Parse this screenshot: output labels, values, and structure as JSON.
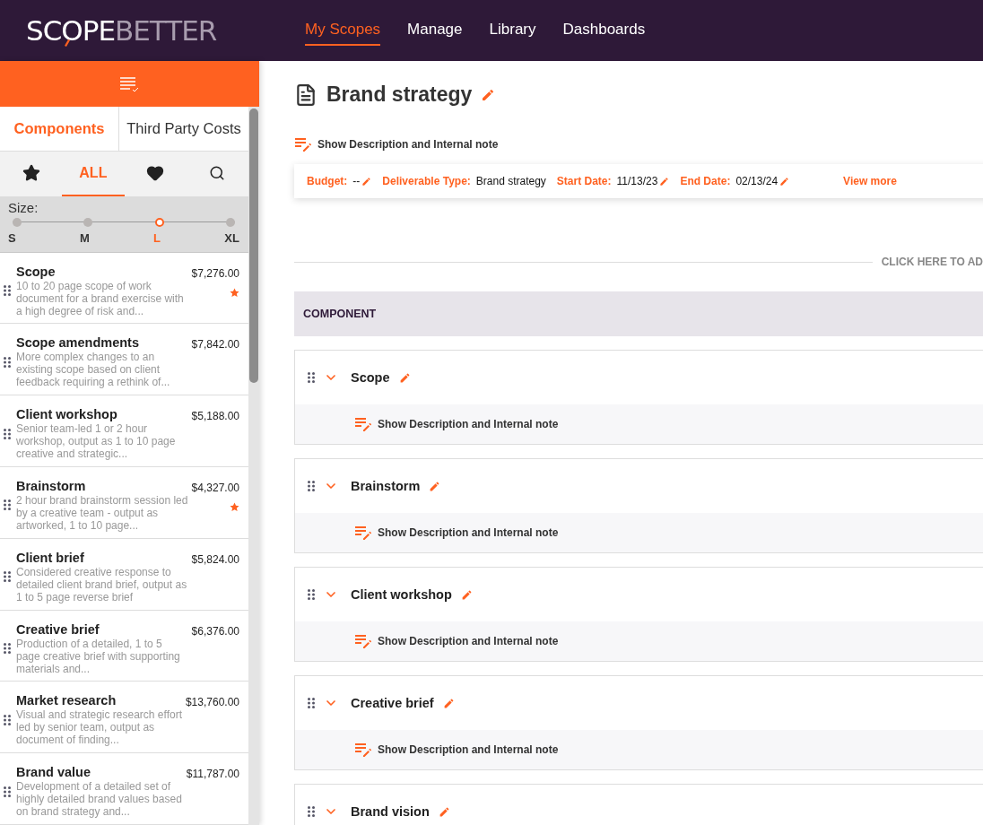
{
  "logo": {
    "first": "SCOPE",
    "second": "BETTER"
  },
  "nav": [
    {
      "label": "My Scopes",
      "selected": true
    },
    {
      "label": "Manage",
      "selected": false
    },
    {
      "label": "Library",
      "selected": false
    },
    {
      "label": "Dashboards",
      "selected": false
    }
  ],
  "sidebar": {
    "tabs": [
      {
        "label": "Components",
        "selected": true
      },
      {
        "label": "Third Party Costs",
        "selected": false
      }
    ],
    "filters": [
      {
        "kind": "star",
        "selected": false
      },
      {
        "kind": "text",
        "label": "ALL",
        "selected": true
      },
      {
        "kind": "heart",
        "selected": false
      },
      {
        "kind": "search",
        "selected": false
      }
    ],
    "size": {
      "label": "Size:",
      "stops": [
        {
          "label": "S",
          "selected": false
        },
        {
          "label": "M",
          "selected": false
        },
        {
          "label": "L",
          "selected": true
        },
        {
          "label": "XL",
          "selected": false
        }
      ]
    },
    "items": [
      {
        "name": "Scope",
        "price": "$7,276.00",
        "description": "10 to 20 page scope of work document for a brand exercise with a high degree of risk and...",
        "starred": true
      },
      {
        "name": "Scope amendments",
        "price": "$7,842.00",
        "description": "More complex changes to an existing scope based on client feedback requiring a rethink of...",
        "starred": false
      },
      {
        "name": "Client workshop",
        "price": "$5,188.00",
        "description": "Senior team-led 1 or 2 hour workshop, output as 1 to 10 page creative and strategic...",
        "starred": false
      },
      {
        "name": "Brainstorm",
        "price": "$4,327.00",
        "description": "2 hour brand brainstorm session led by a creative team - output as artworked, 1 to 10 page...",
        "starred": true
      },
      {
        "name": "Client brief",
        "price": "$5,824.00",
        "description": "Considered creative response to detailed client brand brief, output as 1 to 5 page reverse brief",
        "starred": false
      },
      {
        "name": "Creative brief",
        "price": "$6,376.00",
        "description": "Production of a detailed, 1 to 5 page creative brief with supporting materials and...",
        "starred": false
      },
      {
        "name": "Market research",
        "price": "$13,760.00",
        "description": "Visual and strategic research effort led by senior team, output as document of finding...",
        "starred": false
      },
      {
        "name": "Brand value",
        "price": "$11,787.00",
        "description": "Development of a detailed set of highly detailed brand values based on brand strategy and...",
        "starred": false
      }
    ]
  },
  "main": {
    "title": "Brand strategy",
    "show_note": "Show Description and Internal note",
    "details": [
      {
        "label": "Budget:",
        "value": "--",
        "editable": true
      },
      {
        "label": "Deliverable Type:",
        "value": "Brand strategy",
        "editable": false
      },
      {
        "label": "Start Date:",
        "value": "11/13/23",
        "editable": true
      },
      {
        "label": "End Date:",
        "value": "02/13/24",
        "editable": true
      }
    ],
    "view_more": "View more",
    "add_hint": "CLICK HERE TO AD",
    "section_header": "COMPONENT",
    "components": [
      {
        "name": "Scope",
        "note": "Show Description and Internal note"
      },
      {
        "name": "Brainstorm",
        "note": "Show Description and Internal note"
      },
      {
        "name": "Client workshop",
        "note": "Show Description and Internal note"
      },
      {
        "name": "Creative brief",
        "note": "Show Description and Internal note"
      },
      {
        "name": "Brand vision"
      }
    ]
  }
}
